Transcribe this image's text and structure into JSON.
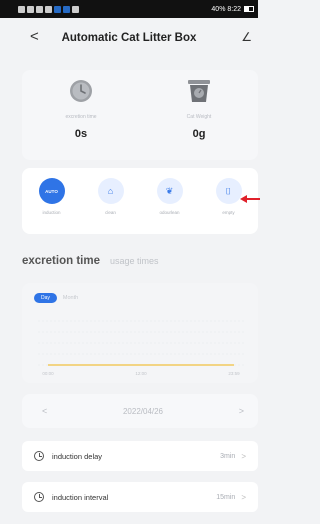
{
  "status_bar": {
    "right_text": "40% 8:22"
  },
  "header": {
    "title": "Automatic Cat Litter Box",
    "back_glyph": "<",
    "edit_glyph": "∠"
  },
  "stats": [
    {
      "label": "excretion time",
      "value": "0s",
      "icon": "clock-icon"
    },
    {
      "label": "Cat Weight",
      "value": "0g",
      "icon": "scale-icon"
    }
  ],
  "modes": [
    {
      "label": "induction",
      "icon": "auto-icon",
      "text": "AUTO",
      "active": true
    },
    {
      "label": "clean",
      "icon": "house-icon",
      "text": "⌂",
      "active": false
    },
    {
      "label": "odourlean",
      "icon": "leaf-icon",
      "text": "❦",
      "active": false
    },
    {
      "label": "empty",
      "icon": "trash-icon",
      "text": "⌷",
      "active": false
    }
  ],
  "section": {
    "tab_main": "excretion time",
    "tab_sub": "usage times"
  },
  "chart": {
    "range_active": "Day",
    "range_other": "Month"
  },
  "chart_data": {
    "type": "line",
    "x": [
      "00:00",
      "12:00",
      "23:59"
    ],
    "series": [
      {
        "values": [
          0,
          0,
          0
        ]
      }
    ],
    "ylim": [
      0,
      4
    ],
    "grid": true,
    "color": "#f0c040"
  },
  "date_row": {
    "prev": "<",
    "date": "2022/04/26",
    "next": ">"
  },
  "settings": [
    {
      "label": "induction delay",
      "value": "3min",
      "chevron": ">"
    },
    {
      "label": "induction interval",
      "value": "15min",
      "chevron": ">"
    }
  ],
  "colors": {
    "accent": "#2f74e6",
    "annotation_arrow": "#e0202a"
  }
}
